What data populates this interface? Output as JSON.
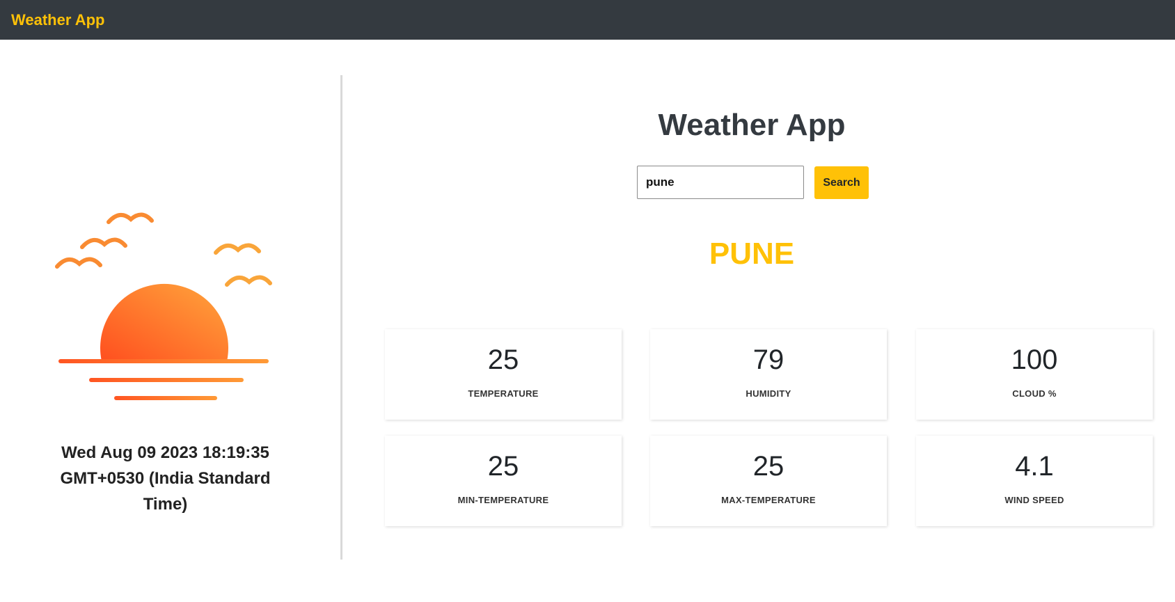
{
  "navbar": {
    "brand": "Weather App"
  },
  "left_panel": {
    "illustration": "sunset-with-birds-icon",
    "datetime": "Wed Aug 09 2023 18:19:35 GMT+0530 (India Standard Time)"
  },
  "main": {
    "title": "Weather App",
    "search": {
      "value": "pune",
      "placeholder": "",
      "button_label": "Search"
    },
    "city": "PUNE",
    "cards": [
      {
        "value": "25",
        "label": "TEMPERATURE"
      },
      {
        "value": "79",
        "label": "HUMIDITY"
      },
      {
        "value": "100",
        "label": "CLOUD %"
      },
      {
        "value": "25",
        "label": "MIN-TEMPERATURE"
      },
      {
        "value": "25",
        "label": "MAX-TEMPERATURE"
      },
      {
        "value": "4.1",
        "label": "WIND SPEED"
      }
    ]
  },
  "colors": {
    "navbar_bg": "#343a40",
    "accent": "#ffc107",
    "sun_gradient_start": "#ff5a1f",
    "sun_gradient_end": "#ffa23a"
  }
}
